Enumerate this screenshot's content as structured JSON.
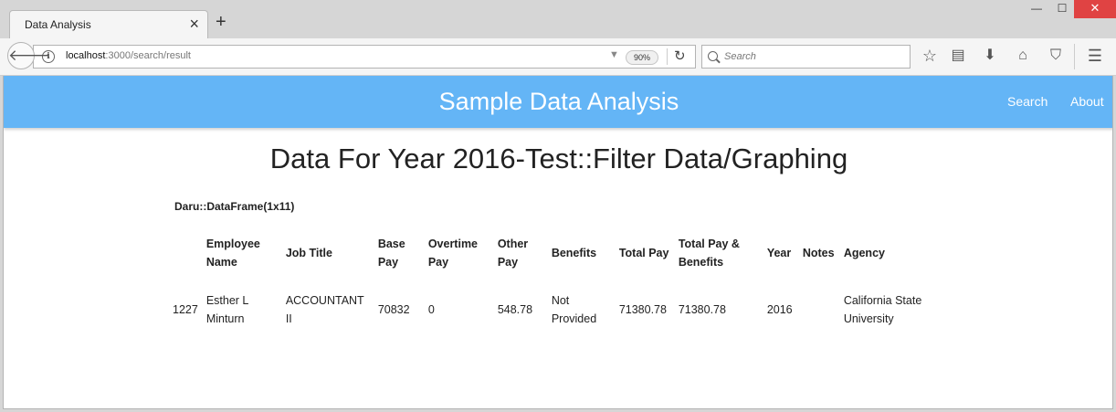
{
  "browser": {
    "tab_title": "Data Analysis",
    "new_tab_label": "+",
    "url_host": "localhost",
    "url_rest": ":3000/search/result",
    "zoom": "90%",
    "search_placeholder": "Search",
    "window_controls": {
      "minimize": "—",
      "maximize": "☐",
      "close": "✕"
    },
    "icons": [
      "back-arrow-icon",
      "info-icon",
      "dropdown-icon",
      "reload-icon",
      "search-icon",
      "star-icon",
      "reader-icon",
      "download-icon",
      "home-icon",
      "pocket-icon",
      "menu-icon"
    ]
  },
  "app": {
    "brand": "Sample Data Analysis",
    "nav": {
      "search": "Search",
      "about": "About"
    },
    "header_color": "#64b5f6"
  },
  "page": {
    "title": "Data For Year 2016-Test::Filter Data/Graphing",
    "dataframe_label": "Daru::DataFrame(1x11)"
  },
  "table": {
    "columns": [
      "",
      "Employee Name",
      "Job Title",
      "Base Pay",
      "Overtime Pay",
      "Other Pay",
      "Benefits",
      "Total Pay",
      "Total Pay & Benefits",
      "Year",
      "Notes",
      "Agency"
    ],
    "rows": [
      [
        "1227",
        "Esther L Minturn",
        "ACCOUNTANT II",
        "70832",
        "0",
        "548.78",
        "Not Provided",
        "71380.78",
        "71380.78",
        "2016",
        "",
        "California State University"
      ]
    ]
  }
}
